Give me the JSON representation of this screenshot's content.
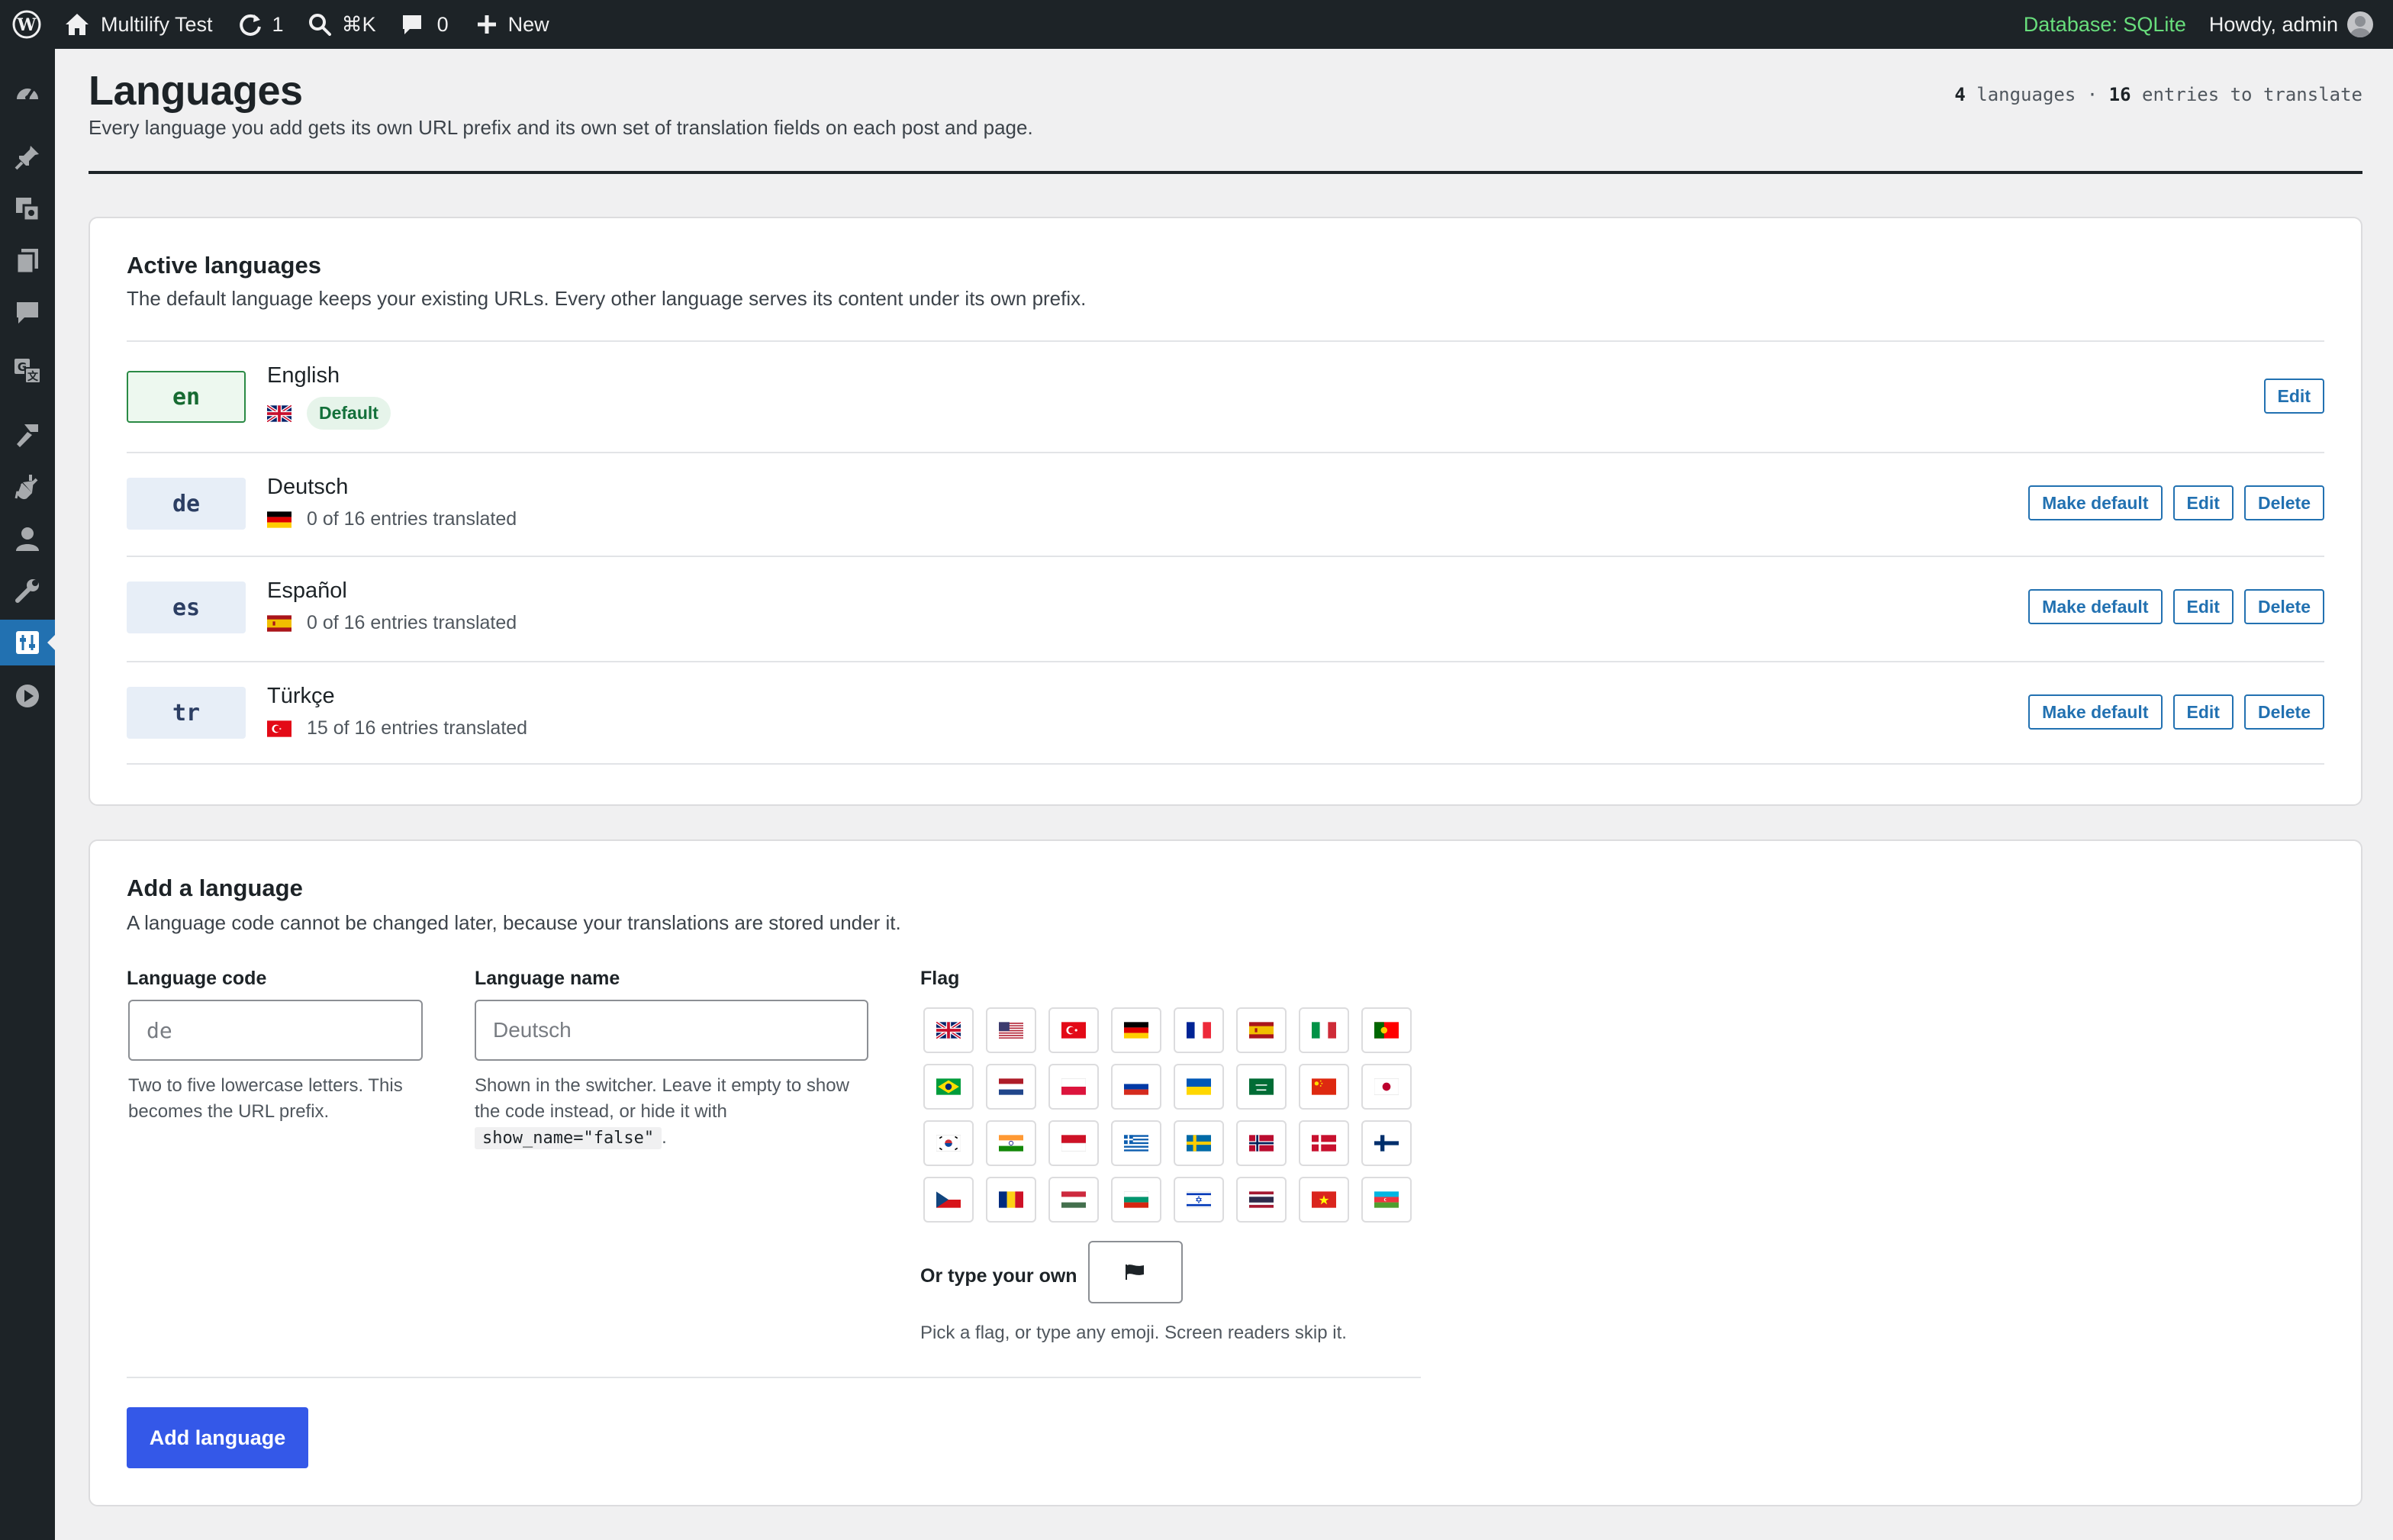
{
  "admin_bar": {
    "site_name": "Multilify Test",
    "updates_count": "1",
    "search_shortcut": "⌘K",
    "comments_count": "0",
    "new_label": "New",
    "database_label": "Database: SQLite",
    "howdy_label": "Howdy, admin"
  },
  "sidebar": {
    "items": [
      "dashboard-icon",
      "posts-icon",
      "media-icon",
      "pages-icon",
      "comments-icon",
      "translate-icon",
      "appearance-icon",
      "plugins-icon",
      "users-icon",
      "tools-icon",
      "settings-icon",
      "play-icon"
    ],
    "current": "settings-icon"
  },
  "page": {
    "title": "Languages",
    "description": "Every language you add gets its own URL prefix and its own set of translation fields on each post and page.",
    "stats": {
      "languages_count": "4",
      "languages_label": "languages",
      "separator": "·",
      "entries_count": "16",
      "entries_label": "entries to translate"
    }
  },
  "active_languages": {
    "title": "Active languages",
    "subtitle": "The default language keeps your existing URLs. Every other language serves its content under its own prefix.",
    "rows": [
      {
        "code": "en",
        "name": "English",
        "flag": "gb",
        "status": "Default",
        "is_default": true
      },
      {
        "code": "de",
        "name": "Deutsch",
        "flag": "de",
        "status": "0 of 16 entries translated",
        "is_default": false
      },
      {
        "code": "es",
        "name": "Español",
        "flag": "es",
        "status": "0 of 16 entries translated",
        "is_default": false
      },
      {
        "code": "tr",
        "name": "Türkçe",
        "flag": "tr",
        "status": "15 of 16 entries translated",
        "is_default": false
      }
    ],
    "actions": {
      "make_default": "Make default",
      "edit": "Edit",
      "delete": "Delete"
    }
  },
  "add_language": {
    "title": "Add a language",
    "subtitle": "A language code cannot be changed later, because your translations are stored under it.",
    "code_label": "Language code",
    "code_placeholder": "de",
    "code_help": "Two to five lowercase letters. This becomes the URL prefix.",
    "name_label": "Language name",
    "name_placeholder": "Deutsch",
    "name_help_before": "Shown in the switcher. Leave it empty to show the code instead, or hide it with",
    "name_help_code": "show_name=\"false\"",
    "name_help_after": ".",
    "flag_label": "Flag",
    "flags": [
      "gb",
      "us",
      "tr",
      "de",
      "fr",
      "es",
      "it",
      "pt",
      "br",
      "nl",
      "pl",
      "ru",
      "ua",
      "sa",
      "cn",
      "jp",
      "kr",
      "in",
      "id",
      "gr",
      "se",
      "no",
      "dk",
      "fi",
      "cz",
      "ro",
      "hu",
      "bg",
      "il",
      "th",
      "vn",
      "az"
    ],
    "own_label": "Or type your own",
    "own_value": "black-flag",
    "flag_help": "Pick a flag, or type any emoji. Screen readers skip it.",
    "submit_label": "Add language"
  },
  "colors": {
    "accent": "#2271b1",
    "primary_button": "#3458e8",
    "default_green": "#2a8a45",
    "db_green": "#68de7c"
  }
}
